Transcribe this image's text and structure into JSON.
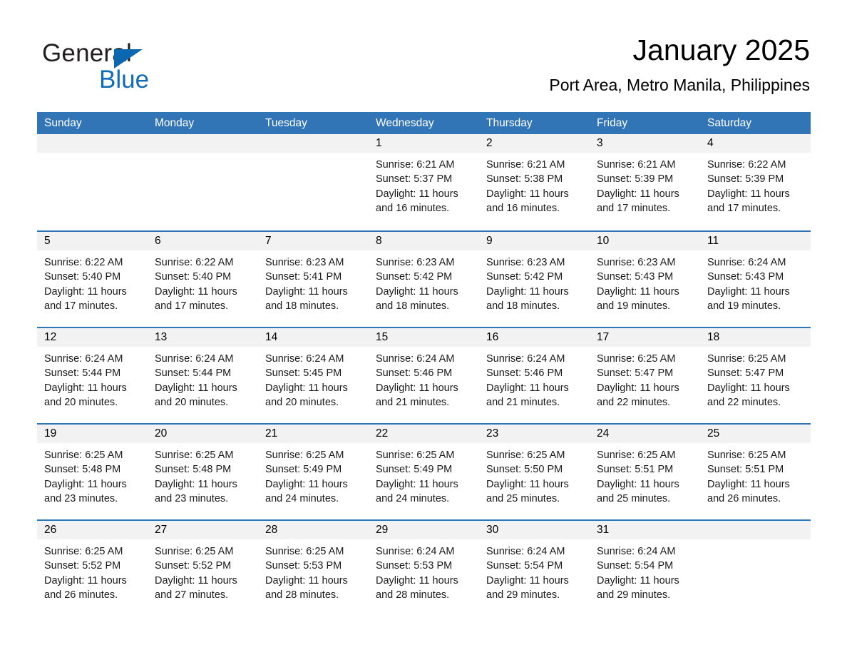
{
  "brand": {
    "name_part1": "General",
    "name_part2": "Blue",
    "triangle_color": "#0b68b0",
    "blue_color": "#0f6cb5"
  },
  "header": {
    "month_title": "January 2025",
    "location": "Port Area, Metro Manila, Philippines"
  },
  "theme": {
    "header_blue": "#3275b6",
    "row_rule_blue": "#2e75b6",
    "daynum_band": "#f2f2f2"
  },
  "weekdays": [
    "Sunday",
    "Monday",
    "Tuesday",
    "Wednesday",
    "Thursday",
    "Friday",
    "Saturday"
  ],
  "weeks": [
    [
      {
        "day": "",
        "sunrise": "",
        "sunset": "",
        "daylight_line1": "",
        "daylight_line2": ""
      },
      {
        "day": "",
        "sunrise": "",
        "sunset": "",
        "daylight_line1": "",
        "daylight_line2": ""
      },
      {
        "day": "",
        "sunrise": "",
        "sunset": "",
        "daylight_line1": "",
        "daylight_line2": ""
      },
      {
        "day": "1",
        "sunrise": "Sunrise: 6:21 AM",
        "sunset": "Sunset: 5:37 PM",
        "daylight_line1": "Daylight: 11 hours",
        "daylight_line2": "and 16 minutes."
      },
      {
        "day": "2",
        "sunrise": "Sunrise: 6:21 AM",
        "sunset": "Sunset: 5:38 PM",
        "daylight_line1": "Daylight: 11 hours",
        "daylight_line2": "and 16 minutes."
      },
      {
        "day": "3",
        "sunrise": "Sunrise: 6:21 AM",
        "sunset": "Sunset: 5:39 PM",
        "daylight_line1": "Daylight: 11 hours",
        "daylight_line2": "and 17 minutes."
      },
      {
        "day": "4",
        "sunrise": "Sunrise: 6:22 AM",
        "sunset": "Sunset: 5:39 PM",
        "daylight_line1": "Daylight: 11 hours",
        "daylight_line2": "and 17 minutes."
      }
    ],
    [
      {
        "day": "5",
        "sunrise": "Sunrise: 6:22 AM",
        "sunset": "Sunset: 5:40 PM",
        "daylight_line1": "Daylight: 11 hours",
        "daylight_line2": "and 17 minutes."
      },
      {
        "day": "6",
        "sunrise": "Sunrise: 6:22 AM",
        "sunset": "Sunset: 5:40 PM",
        "daylight_line1": "Daylight: 11 hours",
        "daylight_line2": "and 17 minutes."
      },
      {
        "day": "7",
        "sunrise": "Sunrise: 6:23 AM",
        "sunset": "Sunset: 5:41 PM",
        "daylight_line1": "Daylight: 11 hours",
        "daylight_line2": "and 18 minutes."
      },
      {
        "day": "8",
        "sunrise": "Sunrise: 6:23 AM",
        "sunset": "Sunset: 5:42 PM",
        "daylight_line1": "Daylight: 11 hours",
        "daylight_line2": "and 18 minutes."
      },
      {
        "day": "9",
        "sunrise": "Sunrise: 6:23 AM",
        "sunset": "Sunset: 5:42 PM",
        "daylight_line1": "Daylight: 11 hours",
        "daylight_line2": "and 18 minutes."
      },
      {
        "day": "10",
        "sunrise": "Sunrise: 6:23 AM",
        "sunset": "Sunset: 5:43 PM",
        "daylight_line1": "Daylight: 11 hours",
        "daylight_line2": "and 19 minutes."
      },
      {
        "day": "11",
        "sunrise": "Sunrise: 6:24 AM",
        "sunset": "Sunset: 5:43 PM",
        "daylight_line1": "Daylight: 11 hours",
        "daylight_line2": "and 19 minutes."
      }
    ],
    [
      {
        "day": "12",
        "sunrise": "Sunrise: 6:24 AM",
        "sunset": "Sunset: 5:44 PM",
        "daylight_line1": "Daylight: 11 hours",
        "daylight_line2": "and 20 minutes."
      },
      {
        "day": "13",
        "sunrise": "Sunrise: 6:24 AM",
        "sunset": "Sunset: 5:44 PM",
        "daylight_line1": "Daylight: 11 hours",
        "daylight_line2": "and 20 minutes."
      },
      {
        "day": "14",
        "sunrise": "Sunrise: 6:24 AM",
        "sunset": "Sunset: 5:45 PM",
        "daylight_line1": "Daylight: 11 hours",
        "daylight_line2": "and 20 minutes."
      },
      {
        "day": "15",
        "sunrise": "Sunrise: 6:24 AM",
        "sunset": "Sunset: 5:46 PM",
        "daylight_line1": "Daylight: 11 hours",
        "daylight_line2": "and 21 minutes."
      },
      {
        "day": "16",
        "sunrise": "Sunrise: 6:24 AM",
        "sunset": "Sunset: 5:46 PM",
        "daylight_line1": "Daylight: 11 hours",
        "daylight_line2": "and 21 minutes."
      },
      {
        "day": "17",
        "sunrise": "Sunrise: 6:25 AM",
        "sunset": "Sunset: 5:47 PM",
        "daylight_line1": "Daylight: 11 hours",
        "daylight_line2": "and 22 minutes."
      },
      {
        "day": "18",
        "sunrise": "Sunrise: 6:25 AM",
        "sunset": "Sunset: 5:47 PM",
        "daylight_line1": "Daylight: 11 hours",
        "daylight_line2": "and 22 minutes."
      }
    ],
    [
      {
        "day": "19",
        "sunrise": "Sunrise: 6:25 AM",
        "sunset": "Sunset: 5:48 PM",
        "daylight_line1": "Daylight: 11 hours",
        "daylight_line2": "and 23 minutes."
      },
      {
        "day": "20",
        "sunrise": "Sunrise: 6:25 AM",
        "sunset": "Sunset: 5:48 PM",
        "daylight_line1": "Daylight: 11 hours",
        "daylight_line2": "and 23 minutes."
      },
      {
        "day": "21",
        "sunrise": "Sunrise: 6:25 AM",
        "sunset": "Sunset: 5:49 PM",
        "daylight_line1": "Daylight: 11 hours",
        "daylight_line2": "and 24 minutes."
      },
      {
        "day": "22",
        "sunrise": "Sunrise: 6:25 AM",
        "sunset": "Sunset: 5:49 PM",
        "daylight_line1": "Daylight: 11 hours",
        "daylight_line2": "and 24 minutes."
      },
      {
        "day": "23",
        "sunrise": "Sunrise: 6:25 AM",
        "sunset": "Sunset: 5:50 PM",
        "daylight_line1": "Daylight: 11 hours",
        "daylight_line2": "and 25 minutes."
      },
      {
        "day": "24",
        "sunrise": "Sunrise: 6:25 AM",
        "sunset": "Sunset: 5:51 PM",
        "daylight_line1": "Daylight: 11 hours",
        "daylight_line2": "and 25 minutes."
      },
      {
        "day": "25",
        "sunrise": "Sunrise: 6:25 AM",
        "sunset": "Sunset: 5:51 PM",
        "daylight_line1": "Daylight: 11 hours",
        "daylight_line2": "and 26 minutes."
      }
    ],
    [
      {
        "day": "26",
        "sunrise": "Sunrise: 6:25 AM",
        "sunset": "Sunset: 5:52 PM",
        "daylight_line1": "Daylight: 11 hours",
        "daylight_line2": "and 26 minutes."
      },
      {
        "day": "27",
        "sunrise": "Sunrise: 6:25 AM",
        "sunset": "Sunset: 5:52 PM",
        "daylight_line1": "Daylight: 11 hours",
        "daylight_line2": "and 27 minutes."
      },
      {
        "day": "28",
        "sunrise": "Sunrise: 6:25 AM",
        "sunset": "Sunset: 5:53 PM",
        "daylight_line1": "Daylight: 11 hours",
        "daylight_line2": "and 28 minutes."
      },
      {
        "day": "29",
        "sunrise": "Sunrise: 6:24 AM",
        "sunset": "Sunset: 5:53 PM",
        "daylight_line1": "Daylight: 11 hours",
        "daylight_line2": "and 28 minutes."
      },
      {
        "day": "30",
        "sunrise": "Sunrise: 6:24 AM",
        "sunset": "Sunset: 5:54 PM",
        "daylight_line1": "Daylight: 11 hours",
        "daylight_line2": "and 29 minutes."
      },
      {
        "day": "31",
        "sunrise": "Sunrise: 6:24 AM",
        "sunset": "Sunset: 5:54 PM",
        "daylight_line1": "Daylight: 11 hours",
        "daylight_line2": "and 29 minutes."
      },
      {
        "day": "",
        "sunrise": "",
        "sunset": "",
        "daylight_line1": "",
        "daylight_line2": ""
      }
    ]
  ]
}
